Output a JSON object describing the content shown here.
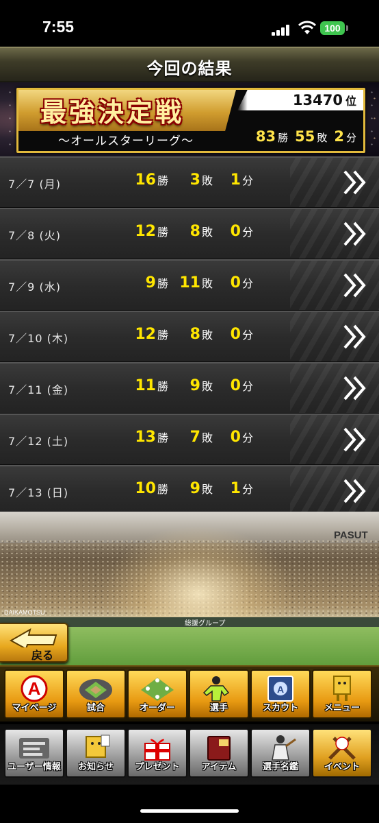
{
  "status_bar": {
    "time": "7:55",
    "battery": "100"
  },
  "header": {
    "title": "今回の結果"
  },
  "banner": {
    "title": "最強決定戦",
    "subtitle": "〜オールスターリーグ〜",
    "rank_value": "13470",
    "rank_unit": "位",
    "wins": "83",
    "losses": "55",
    "draws": "2",
    "win_unit": "勝",
    "loss_unit": "敗",
    "draw_unit": "分"
  },
  "results": [
    {
      "date": "7／7 (月)",
      "wins": "16",
      "losses": "3",
      "draws": "1"
    },
    {
      "date": "7／8 (火)",
      "wins": "12",
      "losses": "8",
      "draws": "0"
    },
    {
      "date": "7／9 (水)",
      "wins": "9",
      "losses": "11",
      "draws": "0"
    },
    {
      "date": "7／10 (木)",
      "wins": "12",
      "losses": "8",
      "draws": "0"
    },
    {
      "date": "7／11 (金)",
      "wins": "11",
      "losses": "9",
      "draws": "0"
    },
    {
      "date": "7／12 (土)",
      "wins": "13",
      "losses": "7",
      "draws": "0"
    },
    {
      "date": "7／13 (日)",
      "wins": "10",
      "losses": "9",
      "draws": "1"
    }
  ],
  "units": {
    "win": "勝",
    "loss": "敗",
    "draw": "分"
  },
  "stadium": {
    "sign_left": "DAIKAMOTSU",
    "sign_center": "総援グループ",
    "sign_right": "PASUT"
  },
  "back_button": {
    "label": "戻る"
  },
  "main_menu": [
    {
      "label": "マイページ",
      "icon": "mypage-icon"
    },
    {
      "label": "試合",
      "icon": "stadium-icon"
    },
    {
      "label": "オーダー",
      "icon": "order-icon"
    },
    {
      "label": "選手",
      "icon": "player-icon"
    },
    {
      "label": "スカウト",
      "icon": "scout-icon"
    },
    {
      "label": "メニュー",
      "icon": "menu-mascot-icon"
    }
  ],
  "sub_menu": [
    {
      "label": "ユーザー情報",
      "icon": "user-info-icon"
    },
    {
      "label": "お知らせ",
      "icon": "news-icon"
    },
    {
      "label": "プレゼント",
      "icon": "gift-icon"
    },
    {
      "label": "アイテム",
      "icon": "item-book-icon"
    },
    {
      "label": "選手名鑑",
      "icon": "player-catalog-icon"
    },
    {
      "label": "イベント",
      "icon": "event-bats-icon"
    }
  ],
  "colors": {
    "accent_yellow": "#ffe600",
    "gold": "#e2b93c",
    "battery_green": "#3fc54f"
  }
}
